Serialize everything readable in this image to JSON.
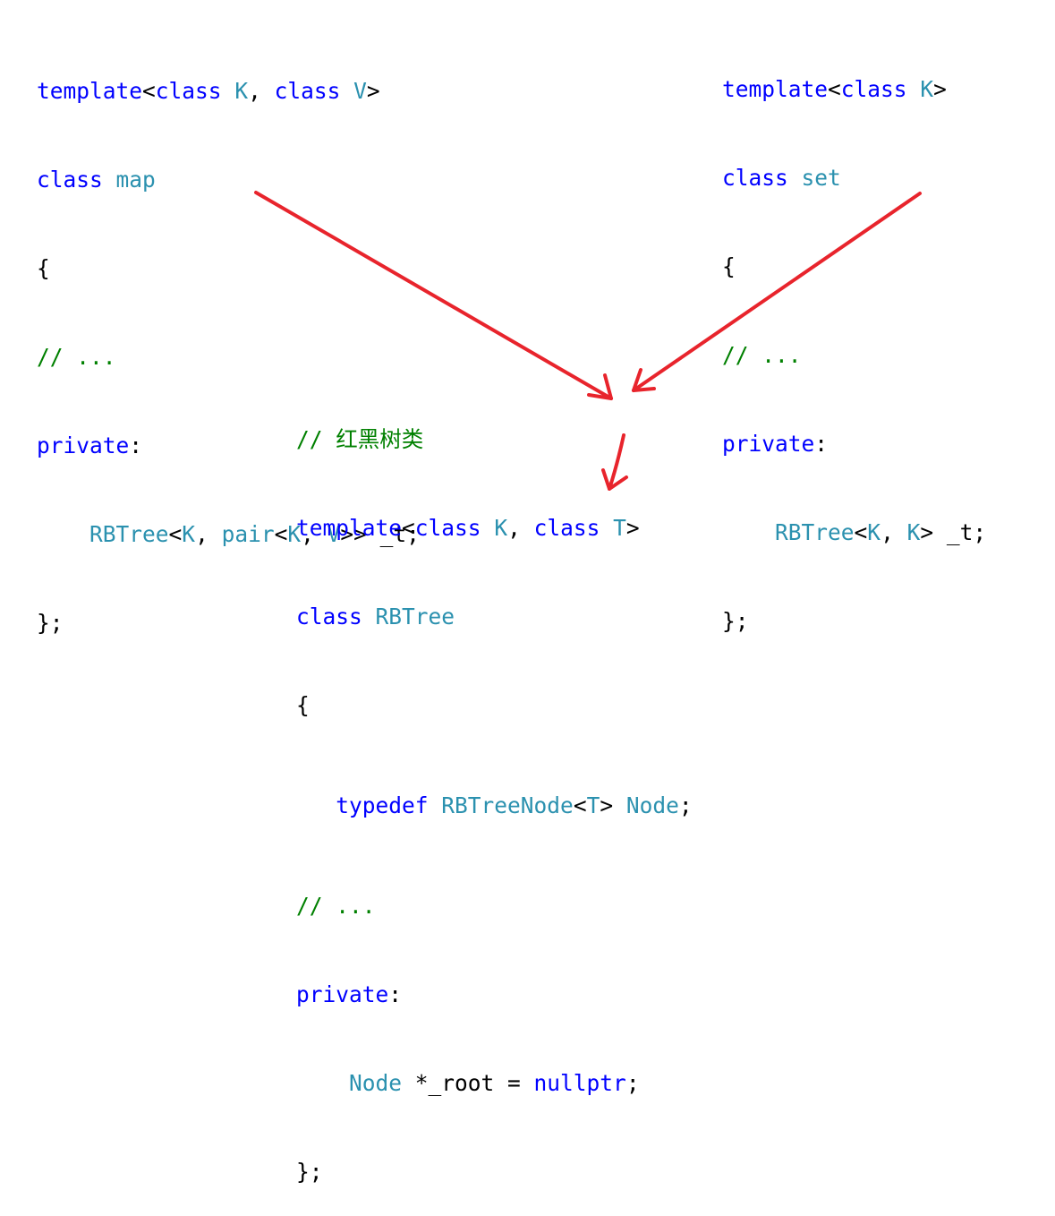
{
  "map_block": {
    "line1": {
      "kw1": "template",
      "p1": "<",
      "kw2": "class",
      "sp1": " ",
      "t1": "K",
      "p2": ", ",
      "kw3": "class",
      "sp2": " ",
      "t2": "V",
      "p3": ">"
    },
    "line2": {
      "kw": "class",
      "sp": " ",
      "name": "map"
    },
    "line3": "{",
    "line4": "// ...",
    "line5": {
      "kw": "private",
      "p": ":"
    },
    "line6": {
      "indent": "    ",
      "t1": "RBTree",
      "p1": "<",
      "t2": "K",
      "p2": ", ",
      "t3": "pair",
      "p3": "<",
      "t4": "K",
      "p4": ", ",
      "t5": "V",
      "p5": ">> _t;"
    },
    "line7": "};"
  },
  "set_block": {
    "line1": {
      "kw1": "template",
      "p1": "<",
      "kw2": "class",
      "sp1": " ",
      "t1": "K",
      "p2": ">"
    },
    "line2": {
      "kw": "class",
      "sp": " ",
      "name": "set"
    },
    "line3": "{",
    "line4": "// ...",
    "line5": {
      "kw": "private",
      "p": ":"
    },
    "line6": {
      "indent": "    ",
      "t1": "RBTree",
      "p1": "<",
      "t2": "K",
      "p2": ", ",
      "t3": "K",
      "p3": "> _t;"
    },
    "line7": "};"
  },
  "rbtree_block": {
    "comment": "// 红黑树类",
    "line1": {
      "kw1": "template",
      "p1": "<",
      "kw2": "class",
      "sp1": " ",
      "t1": "K",
      "p2": ", ",
      "kw3": "class",
      "sp2": " ",
      "t2": "T",
      "p3": ">"
    },
    "line2": {
      "kw": "class",
      "sp": " ",
      "name": "RBTree"
    },
    "line3": "{",
    "typedef": {
      "indent": "   ",
      "kw": "typedef",
      "sp": " ",
      "t1": "RBTreeNode",
      "p1": "<",
      "t2": "T",
      "p2": "> ",
      "t3": "Node",
      "p3": ";"
    },
    "line5": "// ...",
    "line6": {
      "kw": "private",
      "p": ":"
    },
    "line7": {
      "indent": "    ",
      "t1": "Node",
      "p1": " *_root = ",
      "kw": "nullptr",
      "p2": ";"
    },
    "line8": "};"
  },
  "colors": {
    "keyword": "#0000ff",
    "type": "#2b91af",
    "comment": "#008000",
    "arrow": "#e8242c"
  }
}
